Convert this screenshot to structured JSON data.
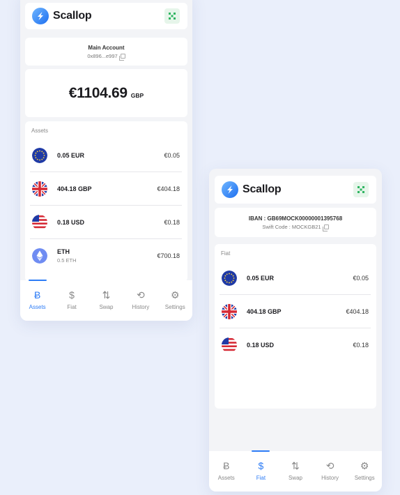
{
  "brand": {
    "name": "Scallop"
  },
  "screen1": {
    "account": {
      "title": "Main Account",
      "address": "0x896...e997"
    },
    "balance": {
      "amount": "€1104.69",
      "currency": "GBP"
    },
    "assets_label": "Assets",
    "assets": [
      {
        "name": "0.05 EUR",
        "sub": "",
        "value": "€0.05",
        "icon": "eu-flag-icon"
      },
      {
        "name": "404.18 GBP",
        "sub": "",
        "value": "€404.18",
        "icon": "uk-flag-icon"
      },
      {
        "name": "0.18 USD",
        "sub": "",
        "value": "€0.18",
        "icon": "us-flag-icon"
      },
      {
        "name": "ETH",
        "sub": "0.5 ETH",
        "value": "€700.18",
        "icon": "ethereum-icon"
      }
    ]
  },
  "screen2": {
    "iban": "IBAN : GB69MOCK00000001395768",
    "swift": "Swift Code : MOCKGB21",
    "fiat_label": "Fiat",
    "fiat": [
      {
        "name": "0.05 EUR",
        "value": "€0.05",
        "icon": "eu-flag-icon"
      },
      {
        "name": "404.18 GBP",
        "value": "€404.18",
        "icon": "uk-flag-icon"
      },
      {
        "name": "0.18 USD",
        "value": "€0.18",
        "icon": "us-flag-icon"
      }
    ]
  },
  "nav": {
    "items": [
      {
        "label": "Assets",
        "glyph": "Ƀ",
        "icon": "bitcoin-icon"
      },
      {
        "label": "Fiat",
        "glyph": "$",
        "icon": "dollar-icon"
      },
      {
        "label": "Swap",
        "glyph": "⇅",
        "icon": "swap-arrows-icon"
      },
      {
        "label": "History",
        "glyph": "⟲",
        "icon": "history-icon"
      },
      {
        "label": "Settings",
        "glyph": "⚙",
        "icon": "gear-icon"
      }
    ]
  },
  "colors": {
    "accent": "#2d7cf6",
    "background": "#eaeffb",
    "eth": "#6f8cf2"
  }
}
